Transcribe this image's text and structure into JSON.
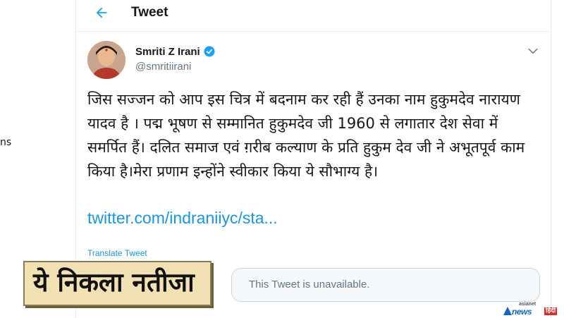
{
  "side": {
    "edge_text": "ns"
  },
  "header": {
    "title": "Tweet",
    "back_icon": "arrow-left-icon"
  },
  "tweet": {
    "author_name": "Smriti Z Irani",
    "handle": "@smritiirani",
    "verified_icon": "verified-badge-icon",
    "menu_icon": "chevron-down-icon",
    "text": "जिस सज्जन को आप इस चित्र में बदनाम कर रही हैं उनका नाम हुकुमदेव नारायण यादव है । पद्म भूषण से सम्मानित हुकुमदेव जी 1960 से लगातार देश सेवा में समर्पित हैं। दलित समाज एवं ग़रीब कल्याण के प्रति हुकुम देव जी ने अभूतपूर्व काम किया है।मेरा प्रणाम इन्होंने स्वीकार किया ये सौभाग्य है।",
    "link": "twitter.com/indraniiyc/sta...",
    "translate_label": "Translate Tweet",
    "quoted_unavailable": "This Tweet is unavailable."
  },
  "overlay": {
    "caption": "ये निकला नतीजा"
  },
  "watermark": {
    "top": "asianet",
    "main": "news",
    "hindi": "हिंदी"
  },
  "colors": {
    "accent": "#1da1f2",
    "link": "#1b95e0",
    "secondary": "#657786",
    "caption_bg": "#f3e1b6"
  }
}
